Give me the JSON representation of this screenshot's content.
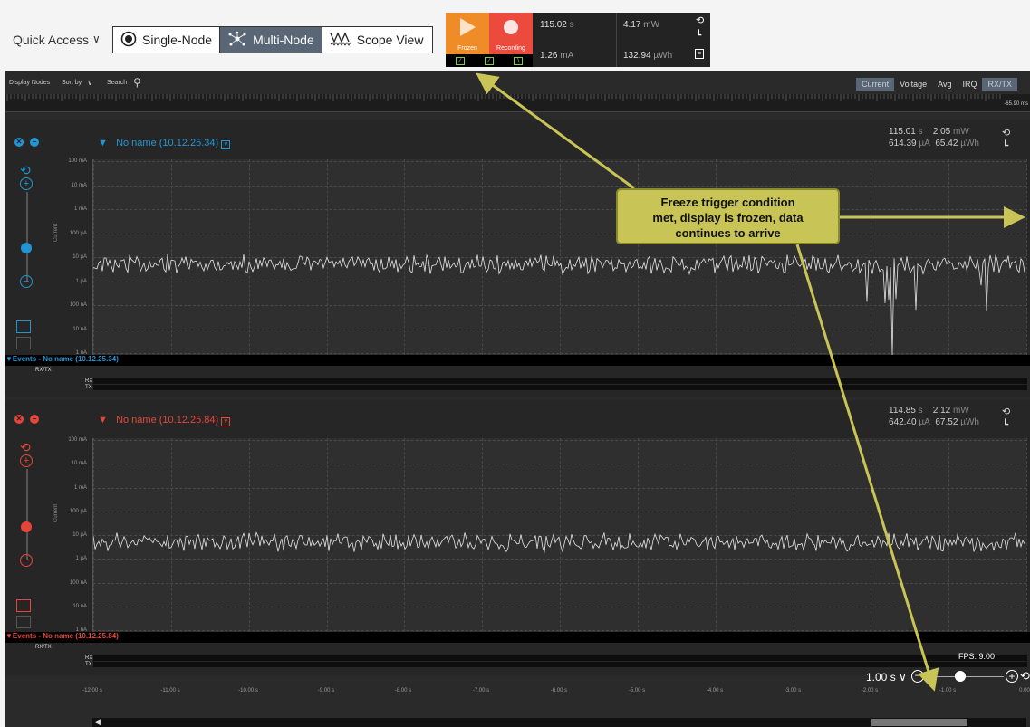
{
  "top_bar": {
    "quick_access_label": "Quick Access",
    "view_buttons": [
      {
        "label": "Single-Node",
        "icon": "radio-target-icon",
        "active": false
      },
      {
        "label": "Multi-Node",
        "icon": "network-nodes-icon",
        "active": true
      },
      {
        "label": "Scope View",
        "icon": "waveform-icon",
        "active": false
      }
    ]
  },
  "recording": {
    "frozen_label": "Frozen",
    "recording_label": "Recording",
    "time": "115.02",
    "time_unit": "s",
    "power": "4.17",
    "power_unit": "mW",
    "current": "1.26",
    "current_unit": "mA",
    "energy": "132.94",
    "energy_unit": "µWh"
  },
  "toolbar": {
    "display_nodes": "Display Nodes",
    "sort_by": "Sort by",
    "search": "Search",
    "tabs": [
      {
        "label": "Current",
        "active": true
      },
      {
        "label": "Voltage",
        "active": false
      },
      {
        "label": "Avg",
        "active": false
      },
      {
        "label": "IRQ",
        "active": false
      },
      {
        "label": "RX/TX",
        "active": true
      }
    ],
    "ruler_label": "-65.90 ms"
  },
  "y_axis": {
    "label": "Current",
    "ticks": [
      "100 mA",
      "10 mA",
      "1 mA",
      "100 µA",
      "10 µA",
      "1 µA",
      "100 nA",
      "10 nA",
      "1 nA"
    ],
    "scale": "log"
  },
  "nodes": [
    {
      "name": "No name (10.12.25.34)",
      "color": "#2196d6",
      "time": "115.01",
      "time_unit": "s",
      "power": "2.05",
      "power_unit": "mW",
      "current": "614.39",
      "current_unit": "µA",
      "energy": "65.42",
      "energy_unit": "µWh",
      "events_label": "Events - No name (10.12.25.34)",
      "rxtx_label": "RX/TX",
      "rx_label": "RX",
      "tx_label": "TX"
    },
    {
      "name": "No name (10.12.25.84)",
      "color": "#e8453a",
      "time": "114.85",
      "time_unit": "s",
      "power": "2.12",
      "power_unit": "mW",
      "current": "642.40",
      "current_unit": "µA",
      "energy": "67.52",
      "energy_unit": "µWh",
      "events_label": "Events - No name (10.12.25.84)",
      "rxtx_label": "RX/TX",
      "rx_label": "RX",
      "tx_label": "TX"
    }
  ],
  "x_axis": {
    "ticks": [
      "-12.00 s",
      "-11.00 s",
      "-10.00 s",
      "-9.00 s",
      "-8.00 s",
      "-7.00 s",
      "-6.00 s",
      "-5.00 s",
      "-4.00 s",
      "-3.00 s",
      "-2.00 s",
      "-1.00 s",
      "0.00"
    ]
  },
  "footer": {
    "fps": "FPS: 9.00",
    "zoom_time": "1.00 s"
  },
  "callout": {
    "line1": "Freeze trigger condition",
    "line2": "met, display is frozen, data",
    "line3": "continues to arrive",
    "color": "#c8c456"
  }
}
